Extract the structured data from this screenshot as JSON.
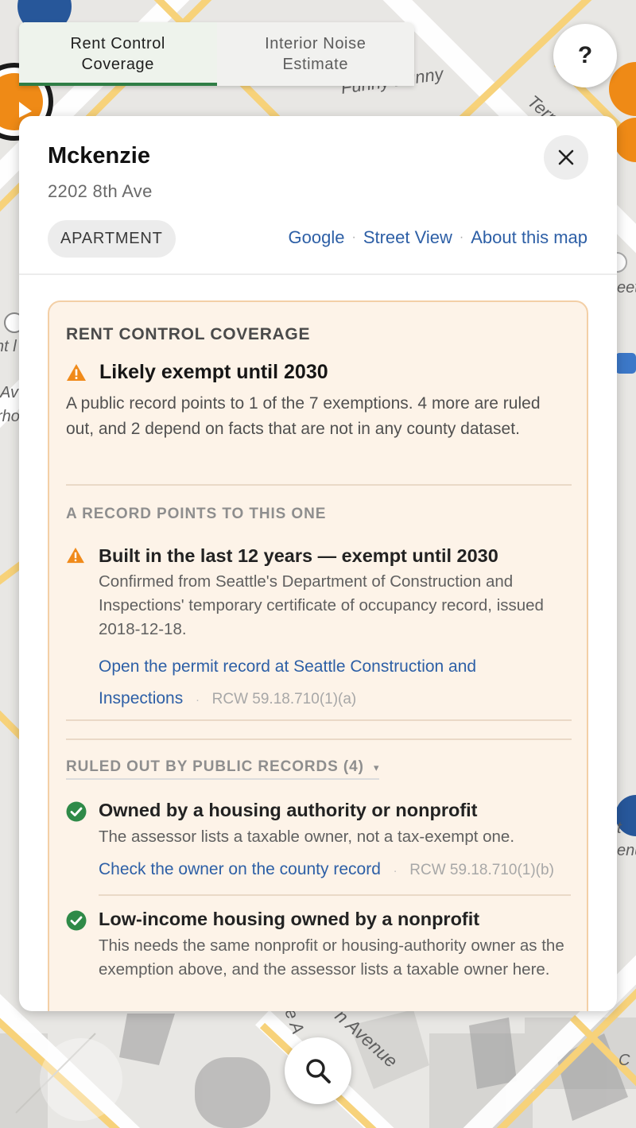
{
  "tabs": [
    {
      "label_line1": "Rent Control",
      "label_line2": "Coverage",
      "active": true
    },
    {
      "label_line1": "Interior Noise",
      "label_line2": "Estimate",
      "active": false
    }
  ],
  "help_label": "?",
  "map_labels": {
    "bunny": "Funny Bunny",
    "tern": "Tern",
    "avenue": "n Avenue",
    "left_a": "Av",
    "left_b": "rho",
    "left_c": "nt l",
    "right_a": "eet",
    "right_b": "t",
    "right_c": "enu",
    "bottom_a": "e A",
    "bottom_b": "C"
  },
  "building": {
    "name": "Mckenzie",
    "address": "2202 8th Ave",
    "type": "APARTMENT"
  },
  "header_links": [
    "Google",
    "Street View",
    "About this map"
  ],
  "coverage": {
    "section_title": "RENT CONTROL COVERAGE",
    "status": "Likely exempt until 2030",
    "summary": "A public record points to 1 of the 7 exemptions. 4 more are ruled out, and 2 depend on facts that are not in any county dataset.",
    "record_section": "A RECORD POINTS TO THIS ONE",
    "record_item": {
      "title": "Built in the last 12 years — exempt until 2030",
      "body": "Confirmed from Seattle's Department of Construction and Inspections' temporary certificate of occupancy record, issued 2018-12-18.",
      "link_line1": "Open the permit record at Seattle Construction and",
      "link_line2": "Inspections",
      "citation": "RCW 59.18.710(1)(a)"
    },
    "ruled_out_title": "RULED OUT BY PUBLIC RECORDS (4)",
    "ruled_out_caret": "▾",
    "ruled_out": [
      {
        "title": "Owned by a housing authority or nonprofit",
        "body": "The assessor lists a taxable owner, not a tax-exempt one.",
        "link": "Check the owner on the county record",
        "citation": "RCW 59.18.710(1)(b)"
      },
      {
        "title": "Low-income housing owned by a nonprofit",
        "body": "This needs the same nonprofit or housing-authority owner as the exemption above, and the assessor lists a taxable owner here."
      }
    ]
  },
  "colors": {
    "accent_green": "#2f7d45",
    "link_blue": "#2d5fa6",
    "warning_orange": "#f08a1a",
    "card_bg": "#fdf3e8",
    "card_border": "#f3cfa6"
  }
}
